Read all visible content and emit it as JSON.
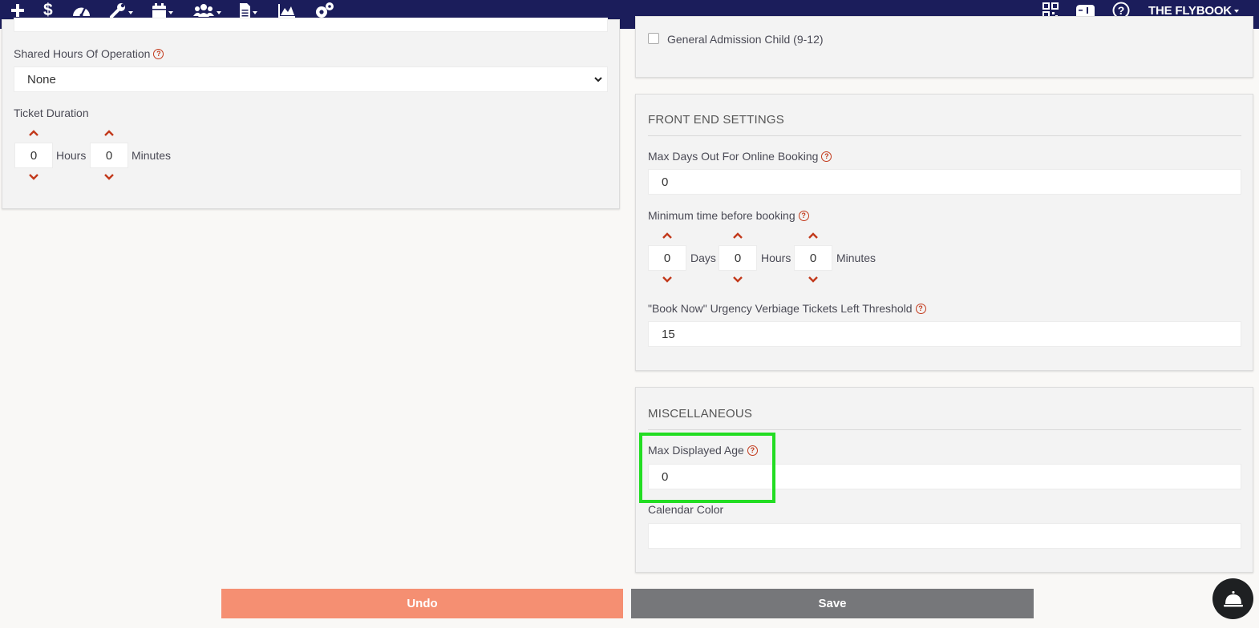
{
  "nav": {
    "icons": [
      "plus-icon",
      "dollar-icon",
      "dashboard-icon",
      "wrench-icon",
      "calendar-icon",
      "users-icon",
      "document-icon",
      "chart-icon",
      "gears-icon"
    ],
    "right_icons": [
      "qrcode-icon",
      "mailbox-icon",
      "help-circle-icon"
    ],
    "brand": "THE FLYBOOK"
  },
  "left_panel": {
    "shared_hours_label": "Shared Hours Of Operation",
    "shared_hours_value": "None",
    "ticket_duration_label": "Ticket Duration",
    "duration_hours": "0",
    "duration_hours_unit": "Hours",
    "duration_minutes": "0",
    "duration_minutes_unit": "Minutes"
  },
  "top_right_panel": {
    "checkbox_label": "General Admission Child (9-12)"
  },
  "front_end": {
    "title": "FRONT END SETTINGS",
    "max_days_label": "Max Days Out For Online Booking",
    "max_days_value": "0",
    "min_time_label": "Minimum time before booking",
    "min_days": "0",
    "min_days_unit": "Days",
    "min_hours": "0",
    "min_hours_unit": "Hours",
    "min_minutes": "0",
    "min_minutes_unit": "Minutes",
    "urgency_label": "\"Book Now\" Urgency Verbiage Tickets Left Threshold",
    "urgency_value": "15"
  },
  "misc": {
    "title": "MISCELLANEOUS",
    "max_age_label": "Max Displayed Age",
    "max_age_value": "0",
    "calendar_color_label": "Calendar Color",
    "calendar_color_value": ""
  },
  "footer": {
    "undo_label": "Undo",
    "save_label": "Save"
  },
  "colors": {
    "nav_bg": "#1b1d5b",
    "accent_red": "#c2391b",
    "undo_bg": "#f58f72",
    "save_bg": "#76777a",
    "highlight": "#22dd22"
  }
}
